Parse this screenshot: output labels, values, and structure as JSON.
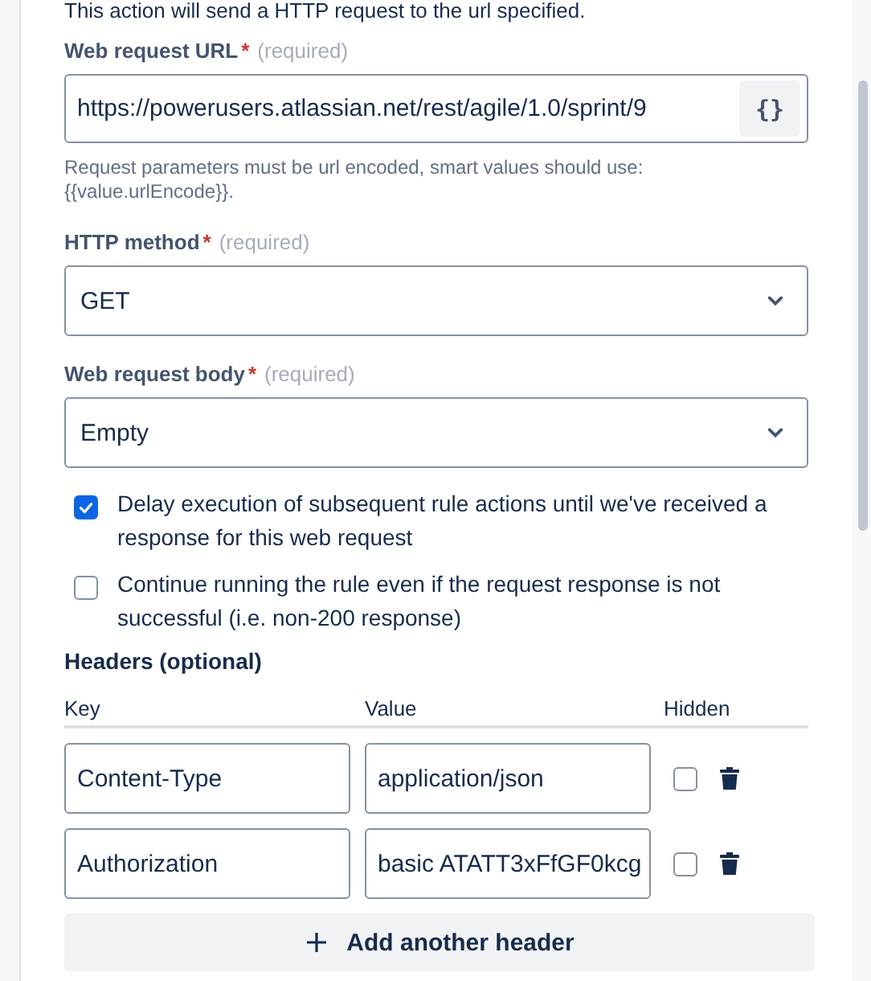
{
  "description": "This action will send a HTTP request to the url specified.",
  "url_field": {
    "label": "Web request URL",
    "required_mark": "*",
    "required_hint": "(required)",
    "value": "https://powerusers.atlassian.net/rest/agile/1.0/sprint/9",
    "button": "{}",
    "help": "Request parameters must be url encoded, smart values should use: {{value.urlEncode}}."
  },
  "selects": [
    {
      "label": "HTTP method",
      "required_mark": "*",
      "required_hint": "(required)",
      "value": "GET"
    },
    {
      "label": "Web request body",
      "required_mark": "*",
      "required_hint": "(required)",
      "value": "Empty"
    }
  ],
  "options": [
    {
      "label": "Delay execution of subsequent rule actions until we've received a response for this web request",
      "checked": true
    },
    {
      "label": "Continue running the rule even if the request response is not successful (i.e. non-200 response)",
      "checked": false
    }
  ],
  "headers": {
    "title": "Headers (optional)",
    "columns": [
      "Key",
      "Value",
      "Hidden"
    ],
    "rows": [
      {
        "key": "Content-Type",
        "value": "application/json",
        "hidden": false
      },
      {
        "key": "Authorization",
        "value": "basic ATATT3xFfGF0kcg",
        "hidden": false
      }
    ],
    "add_button": "Add another header"
  }
}
